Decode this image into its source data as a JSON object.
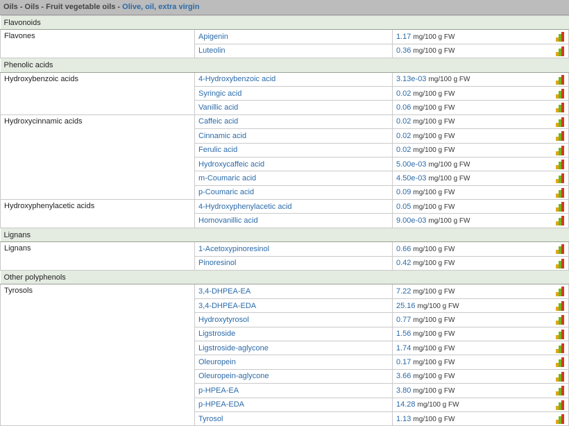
{
  "breadcrumb": {
    "path": "Oils - Oils - Fruit vegetable oils - ",
    "food": "Olive, oil, extra virgin"
  },
  "unit": "mg/100 g FW",
  "groups": [
    {
      "name": "Flavonoids",
      "subgroups": [
        {
          "name": "Flavones",
          "rows": [
            {
              "compound": "Apigenin",
              "value": "1.17"
            },
            {
              "compound": "Luteolin",
              "value": "0.36"
            }
          ]
        }
      ]
    },
    {
      "name": "Phenolic acids",
      "subgroups": [
        {
          "name": "Hydroxybenzoic acids",
          "rows": [
            {
              "compound": "4-Hydroxybenzoic acid",
              "value": "3.13e-03"
            },
            {
              "compound": "Syringic acid",
              "value": "0.02"
            },
            {
              "compound": "Vanillic acid",
              "value": "0.06"
            }
          ]
        },
        {
          "name": "Hydroxycinnamic acids",
          "rows": [
            {
              "compound": "Caffeic acid",
              "value": "0.02"
            },
            {
              "compound": "Cinnamic acid",
              "value": "0.02"
            },
            {
              "compound": "Ferulic acid",
              "value": "0.02"
            },
            {
              "compound": "Hydroxycaffeic acid",
              "value": "5.00e-03"
            },
            {
              "compound": "m-Coumaric acid",
              "value": "4.50e-03"
            },
            {
              "compound": "p-Coumaric acid",
              "value": "0.09"
            }
          ]
        },
        {
          "name": "Hydroxyphenylacetic acids",
          "rows": [
            {
              "compound": "4-Hydroxyphenylacetic acid",
              "value": "0.05"
            },
            {
              "compound": "Homovanillic acid",
              "value": "9.00e-03"
            }
          ]
        }
      ]
    },
    {
      "name": "Lignans",
      "subgroups": [
        {
          "name": "Lignans",
          "rows": [
            {
              "compound": "1-Acetoxypinoresinol",
              "value": "0.66"
            },
            {
              "compound": "Pinoresinol",
              "value": "0.42"
            }
          ]
        }
      ]
    },
    {
      "name": "Other polyphenols",
      "subgroups": [
        {
          "name": "Tyrosols",
          "rows": [
            {
              "compound": "3,4-DHPEA-EA",
              "value": "7.22"
            },
            {
              "compound": "3,4-DHPEA-EDA",
              "value": "25.16"
            },
            {
              "compound": "Hydroxytyrosol",
              "value": "0.77"
            },
            {
              "compound": "Ligstroside",
              "value": "1.56"
            },
            {
              "compound": "Ligstroside-aglycone",
              "value": "1.74"
            },
            {
              "compound": "Oleuropein",
              "value": "0.17"
            },
            {
              "compound": "Oleuropein-aglycone",
              "value": "3.66"
            },
            {
              "compound": "p-HPEA-EA",
              "value": "3.80"
            },
            {
              "compound": "p-HPEA-EDA",
              "value": "14.28"
            },
            {
              "compound": "Tyrosol",
              "value": "1.13"
            }
          ]
        }
      ]
    }
  ]
}
